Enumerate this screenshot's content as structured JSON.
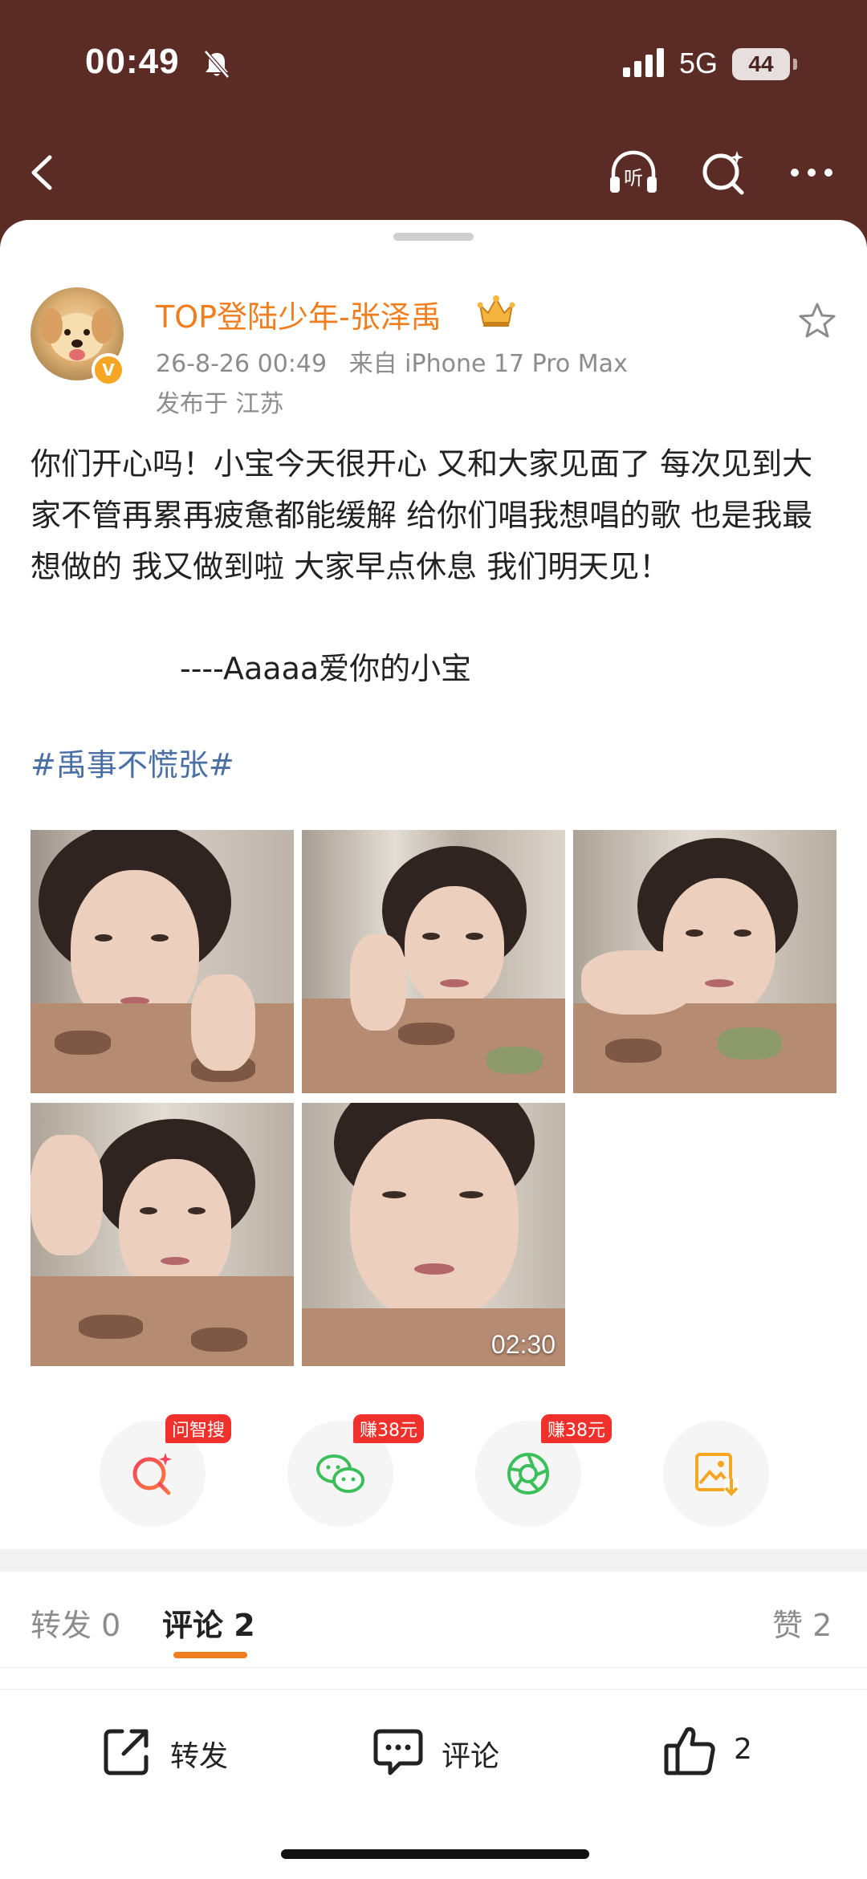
{
  "status_bar": {
    "time": "00:49",
    "network": "5G",
    "battery": "44"
  },
  "nav": {
    "icons": [
      "back-icon",
      "listen-icon",
      "ai-search-icon",
      "more-icon"
    ],
    "listen_label": "听"
  },
  "post": {
    "username": "TOP登陆少年-张泽禹",
    "timestamp": "26-8-26 00:49",
    "source": "来自 iPhone 17 Pro Max",
    "location": "发布于 江苏",
    "text": "你们开心吗！小宝今天很开心 又和大家见面了 每次见到大家不管再累再疲惫都能缓解 给你们唱我想唱的歌 也是我最想做的 我又做到啦 大家早点休息 我们明天见！",
    "signature": "----Aaaaa爱你的小宝",
    "hashtag": "#禹事不慌张#",
    "video_duration": "02:30"
  },
  "share_actions": [
    {
      "name": "ai-search",
      "badge": "问智搜",
      "icon": "ai-search-icon"
    },
    {
      "name": "wechat",
      "badge": "赚38元",
      "icon": "wechat-icon"
    },
    {
      "name": "moments",
      "badge": "赚38元",
      "icon": "moments-icon"
    },
    {
      "name": "save-image",
      "badge": "",
      "icon": "save-image-icon"
    }
  ],
  "tabs": {
    "repost": "转发 0",
    "comment": "评论 2",
    "like": "赞 2"
  },
  "bottom_bar": {
    "repost_label": "转发",
    "comment_label": "评论",
    "like_count": "2"
  },
  "colors": {
    "header_bg": "#5b2b26",
    "username": "#f07d1e",
    "hashtag": "#4a6fa5",
    "badge": "#f0302b",
    "tab_underline": "#f07d1e"
  }
}
